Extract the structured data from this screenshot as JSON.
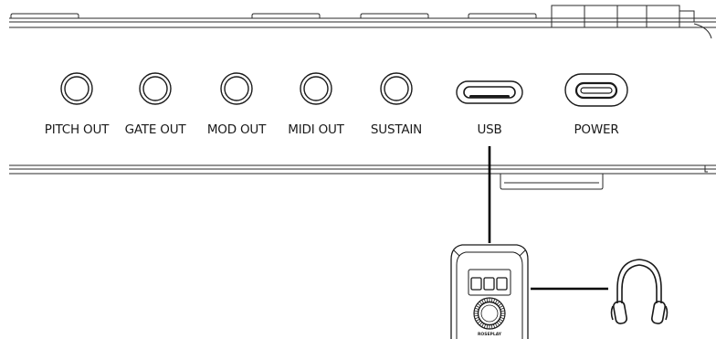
{
  "ports": [
    {
      "label": "PITCH OUT",
      "kind": "jack"
    },
    {
      "label": "GATE OUT",
      "kind": "jack"
    },
    {
      "label": "MOD OUT",
      "kind": "jack"
    },
    {
      "label": "MIDI OUT",
      "kind": "jack"
    },
    {
      "label": "SUSTAIN",
      "kind": "jack"
    },
    {
      "label": "USB",
      "kind": "usb-c-port"
    },
    {
      "label": "POWER",
      "kind": "power-port"
    }
  ],
  "device": {
    "brand_text": "ROSEPLAY",
    "display_buttons": 3,
    "icon": "usb-audio-interface-icon"
  },
  "output_icon": "headphones-icon"
}
